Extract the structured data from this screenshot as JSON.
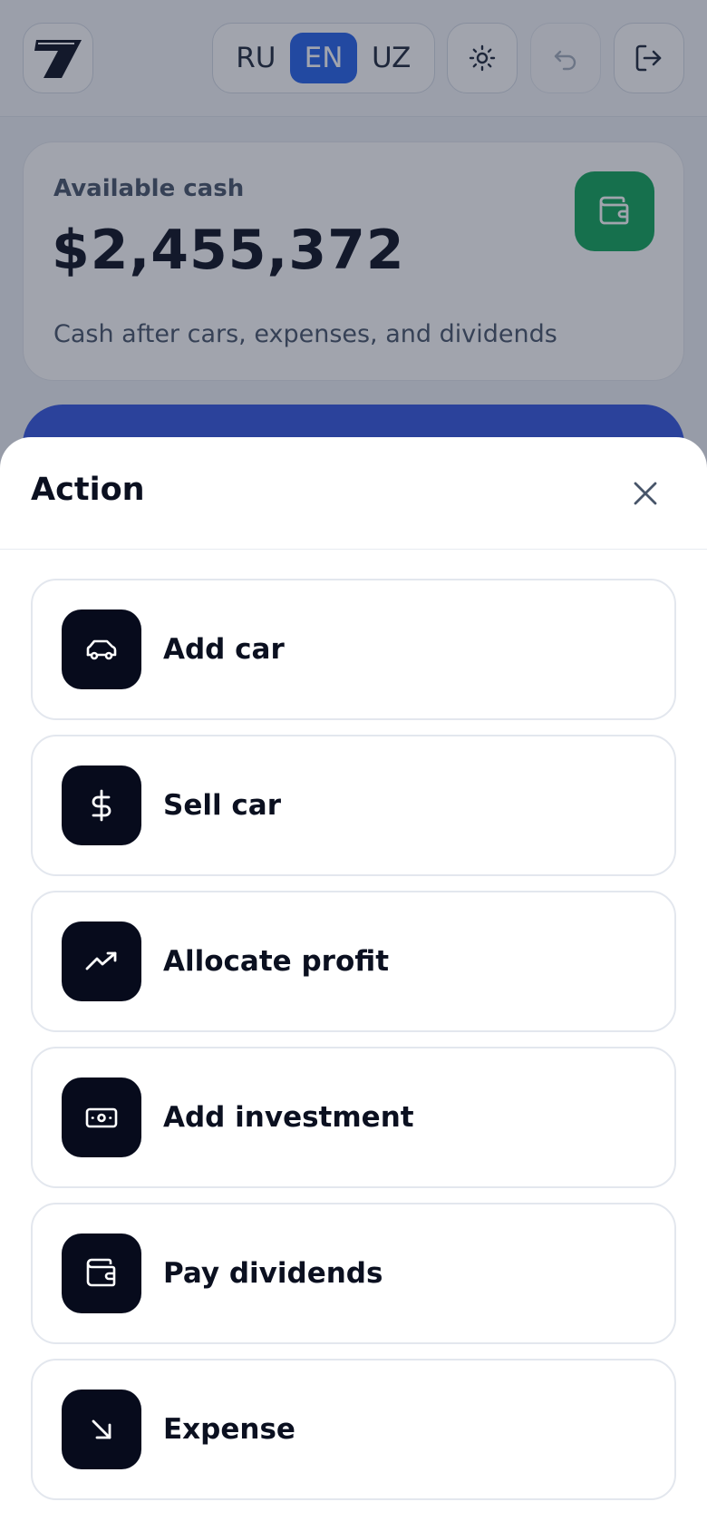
{
  "header": {
    "languages": [
      "RU",
      "EN",
      "UZ"
    ],
    "active_language": "EN"
  },
  "cash": {
    "label": "Available cash",
    "amount": "$2,455,372",
    "subtitle": "Cash after cars, expenses, and dividends"
  },
  "sheet": {
    "title": "Action",
    "actions": [
      {
        "label": "Add car",
        "icon": "car-icon"
      },
      {
        "label": "Sell car",
        "icon": "dollar-icon"
      },
      {
        "label": "Allocate profit",
        "icon": "trending-up-icon"
      },
      {
        "label": "Add investment",
        "icon": "banknote-icon"
      },
      {
        "label": "Pay dividends",
        "icon": "wallet-icon"
      },
      {
        "label": "Expense",
        "icon": "arrow-down-right-icon"
      }
    ]
  },
  "colors": {
    "accent_blue": "#2563eb",
    "wallet_green": "#10a65a",
    "icon_tile": "#070b1c"
  }
}
